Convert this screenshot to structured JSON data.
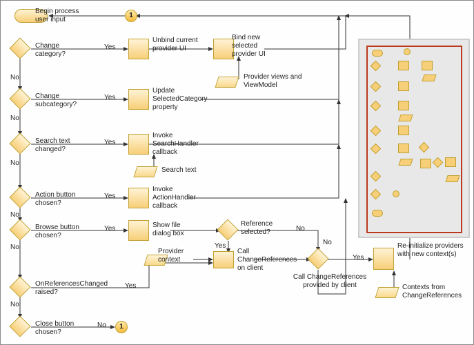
{
  "start_label": "Begin process user input",
  "conn1": "1",
  "d1": {
    "q": "Change category?",
    "yes": "Yes",
    "no": "No"
  },
  "p1": "Unbind current provider UI",
  "p1b": "Bind new selected provider UI",
  "para1": "Provider views and ViewModel",
  "d2": {
    "q": "Change subcategory?",
    "yes": "Yes",
    "no": "No"
  },
  "p2": "Update SelectedCategory property",
  "d3": {
    "q": "Search text changed?",
    "yes": "Yes",
    "no": "No"
  },
  "p3": "Invoke SearchHandler callback",
  "para3": "Search text",
  "d4": {
    "q": "Action button chosen?",
    "yes": "Yes",
    "no": "No"
  },
  "p4": "Invoke ActionHandler callback",
  "d5": {
    "q": "Browse button chosen?",
    "yes": "Yes",
    "no": "No"
  },
  "p5": "Show file dialog box",
  "d5b": {
    "q": "Reference selected?",
    "yes": "Yes",
    "no": "No"
  },
  "para5": "Provider context",
  "p6": "Call ChangeReferences on client",
  "d6": {
    "q": "OnReferencesChanged raised?",
    "yes": "Yes",
    "no": "No"
  },
  "d7": {
    "q": "Close button chosen?",
    "no": "No"
  },
  "d8": {
    "q": "Call ChangeReferences provided by client",
    "yes": "Yes",
    "no": "No"
  },
  "p8": "Re-initialize providers with new context(s)",
  "para8": "Contexts from ChangeReferences",
  "chart_data": {
    "type": "table",
    "title": "Flowchart: user-input processing loop",
    "nodes": [
      {
        "id": "start",
        "type": "terminator",
        "label": "Begin process user input"
      },
      {
        "id": "c1",
        "type": "connector",
        "label": "1"
      },
      {
        "id": "d1",
        "type": "decision",
        "label": "Change category?"
      },
      {
        "id": "p1",
        "type": "process",
        "label": "Unbind current provider UI"
      },
      {
        "id": "p1b",
        "type": "process",
        "label": "Bind new selected provider UI"
      },
      {
        "id": "para1",
        "type": "data",
        "label": "Provider views and ViewModel"
      },
      {
        "id": "d2",
        "type": "decision",
        "label": "Change subcategory?"
      },
      {
        "id": "p2",
        "type": "process",
        "label": "Update SelectedCategory property"
      },
      {
        "id": "d3",
        "type": "decision",
        "label": "Search text changed?"
      },
      {
        "id": "p3",
        "type": "process",
        "label": "Invoke SearchHandler callback"
      },
      {
        "id": "para3",
        "type": "data",
        "label": "Search text"
      },
      {
        "id": "d4",
        "type": "decision",
        "label": "Action button chosen?"
      },
      {
        "id": "p4",
        "type": "process",
        "label": "Invoke ActionHandler callback"
      },
      {
        "id": "d5",
        "type": "decision",
        "label": "Browse button chosen?"
      },
      {
        "id": "p5",
        "type": "process",
        "label": "Show file dialog box"
      },
      {
        "id": "d5b",
        "type": "decision",
        "label": "Reference selected?"
      },
      {
        "id": "para5",
        "type": "data",
        "label": "Provider context"
      },
      {
        "id": "p6",
        "type": "process",
        "label": "Call ChangeReferences on client"
      },
      {
        "id": "d6",
        "type": "decision",
        "label": "OnReferencesChanged raised?"
      },
      {
        "id": "d7",
        "type": "decision",
        "label": "Close button chosen?"
      },
      {
        "id": "c1b",
        "type": "connector",
        "label": "1"
      },
      {
        "id": "d8",
        "type": "decision",
        "label": "Call ChangeReferences provided by client"
      },
      {
        "id": "p8",
        "type": "process",
        "label": "Re-initialize providers with new context(s)"
      },
      {
        "id": "para8",
        "type": "data",
        "label": "Contexts from ChangeReferences"
      }
    ],
    "edges": [
      {
        "from": "c1",
        "to": "start"
      },
      {
        "from": "start",
        "to": "d1"
      },
      {
        "from": "d1",
        "to": "p1",
        "label": "Yes"
      },
      {
        "from": "d1",
        "to": "d2",
        "label": "No"
      },
      {
        "from": "p1",
        "to": "p1b"
      },
      {
        "from": "para1",
        "to": "p1b"
      },
      {
        "from": "p1b",
        "to": "start",
        "style": "feedback"
      },
      {
        "from": "d2",
        "to": "p2",
        "label": "Yes"
      },
      {
        "from": "d2",
        "to": "d3",
        "label": "No"
      },
      {
        "from": "p2",
        "to": "start",
        "style": "feedback"
      },
      {
        "from": "d3",
        "to": "p3",
        "label": "Yes"
      },
      {
        "from": "d3",
        "to": "d4",
        "label": "No"
      },
      {
        "from": "para3",
        "to": "p3"
      },
      {
        "from": "p3",
        "to": "start",
        "style": "feedback"
      },
      {
        "from": "d4",
        "to": "p4",
        "label": "Yes"
      },
      {
        "from": "d4",
        "to": "d5",
        "label": "No"
      },
      {
        "from": "p4",
        "to": "start",
        "style": "feedback"
      },
      {
        "from": "d5",
        "to": "p5",
        "label": "Yes"
      },
      {
        "from": "d5",
        "to": "d6",
        "label": "No"
      },
      {
        "from": "p5",
        "to": "d5b"
      },
      {
        "from": "d5b",
        "to": "p6",
        "label": "Yes"
      },
      {
        "from": "d5b",
        "to": "d8",
        "label": "No",
        "style": "via-right"
      },
      {
        "from": "para5",
        "to": "p6"
      },
      {
        "from": "d6",
        "to": "p6",
        "label": "Yes",
        "style": "up"
      },
      {
        "from": "d6",
        "to": "d7",
        "label": "No"
      },
      {
        "from": "d7",
        "to": "c1b",
        "label": "No"
      },
      {
        "from": "p6",
        "to": "d8"
      },
      {
        "from": "d8",
        "to": "p8",
        "label": "Yes"
      },
      {
        "from": "d8",
        "to": "start",
        "label": "No",
        "style": "feedback"
      },
      {
        "from": "para8",
        "to": "p8"
      },
      {
        "from": "p8",
        "to": "start",
        "style": "feedback"
      }
    ]
  }
}
